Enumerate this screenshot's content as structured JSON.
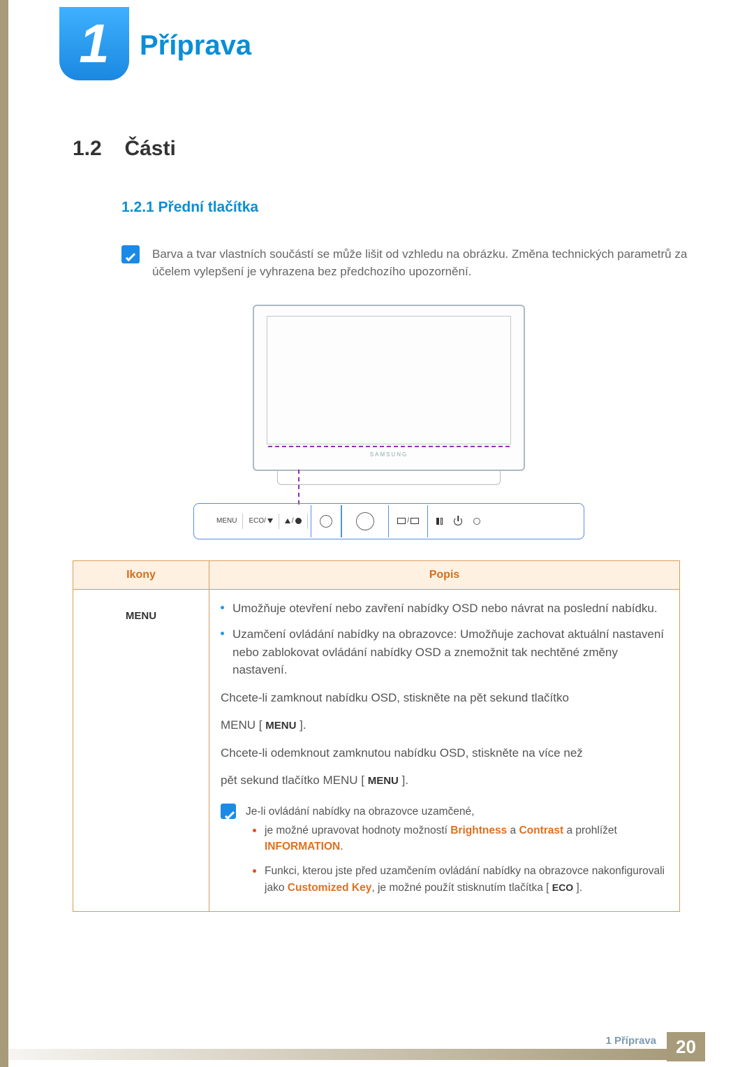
{
  "chapter": {
    "number": "1",
    "title": "Příprava"
  },
  "section": {
    "number": "1.2",
    "title": "Části"
  },
  "subsection": {
    "number_title": "1.2.1  Přední tlačítka"
  },
  "note1": "Barva a tvar vlastních součástí se může lišit od vzhledu na obrázku. Změna technických parametrů za účelem vylepšení je vyhrazena bez předchozího upozornění.",
  "brand": "SAMSUNG",
  "button_bar": {
    "b1": "MENU",
    "b2": "ECO/"
  },
  "table": {
    "header_col1": "Ikony",
    "header_col2": "Popis",
    "row1_icon": "MENU",
    "row1": {
      "bul1": "Umožňuje otevření nebo zavření nabídky OSD nebo návrat na poslední nabídku.",
      "bul2": "Uzamčení ovládání nabídky na obrazovce: Umožňuje zachovat aktuální nastavení nebo zablokovat ovládání nabídky OSD a znemožnit tak nechtěné změny nastavení.",
      "p1": "Chcete-li zamknout nabídku OSD, stiskněte na pět sekund tlačítko",
      "p1b_pre": "MENU [ ",
      "p1b_lbl": "MENU",
      "p1b_post": " ].",
      "p2": "Chcete-li odemknout zamknutou nabídku OSD, stiskněte na více než",
      "p3_pre": "pět sekund tlačítko MENU [ ",
      "p3_lbl": "MENU",
      "p3_post": " ].",
      "note_intro": "Je-li ovládání nabídky na obrazovce uzamčené,",
      "nb1_a": "je možné upravovat hodnoty možností ",
      "nb1_b": "Brightness",
      "nb1_c": " a ",
      "nb1_d": "Contrast",
      "nb1_e": " a prohlížet ",
      "nb1_f": "INFORMATION",
      "nb1_g": ".",
      "nb2_a": "Funkci, kterou jste před uzamčením ovládání nabídky na obrazovce nakonfigurovali jako ",
      "nb2_b": "Customized Key",
      "nb2_c": ", je možné použít stisknutím tlačítka [ ",
      "nb2_lbl": "ECO",
      "nb2_d": " ]."
    }
  },
  "footer": {
    "chapter_ref": "1 Příprava",
    "page": "20"
  }
}
